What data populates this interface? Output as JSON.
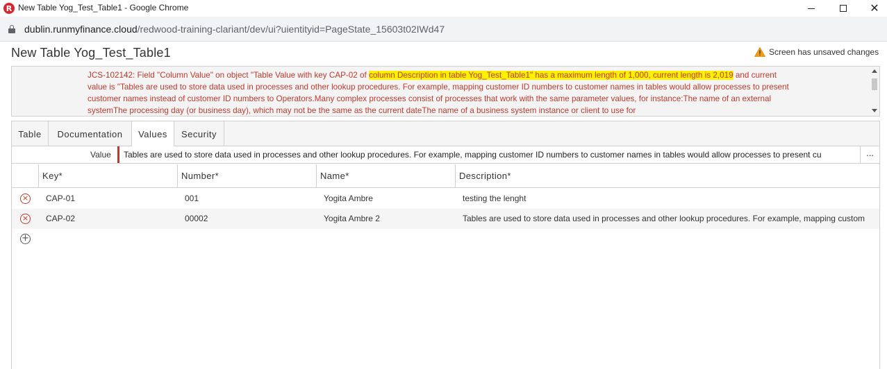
{
  "window": {
    "app_icon": "R",
    "title": "New Table Yog_Test_Table1 - Google Chrome",
    "close_glyph": "✕"
  },
  "addressbar": {
    "host": "dublin.runmyfinance.cloud",
    "path": "/redwood-training-clariant/dev/ui?uientityid=PageState_15603t02IWd47"
  },
  "page": {
    "title": "New Table Yog_Test_Table1",
    "unsaved_text": "Screen has unsaved changes"
  },
  "error": {
    "prefix": "JCS-102142: Field \"Column Value\" on object \"Table Value with key CAP-02 of ",
    "highlight": "column Description in table Yog_Test_Table1\" has a maximum length of 1,000, current length is 2,019",
    "suffix": " and current value is \"Tables are used to store data used in processes and other lookup procedures. For example, mapping customer ID numbers to customer names in tables would allow processes to present customer names instead of customer ID numbers to Operators.Many complex processes consist of processes that work with the same parameter values, for instance:The name of an external systemThe processing day (or business day), which may not be the same as the current dateThe name of a business system instance or client to use for"
  },
  "tabs": [
    {
      "label": "Table"
    },
    {
      "label": "Documentation"
    },
    {
      "label": "Values",
      "active": true
    },
    {
      "label": "Security"
    }
  ],
  "value_field": {
    "label": "Value",
    "value": "Tables are used to store data used in processes and other lookup procedures. For example, mapping customer ID numbers to customer names in tables would allow processes to present cu",
    "more": "..."
  },
  "grid": {
    "columns": [
      "Key*",
      "Number*",
      "Name*",
      "Description*"
    ],
    "rows": [
      {
        "key": "CAP-01",
        "number": "001",
        "name": "Yogita Ambre",
        "description": "testing the lenght"
      },
      {
        "key": "CAP-02",
        "number": "00002",
        "name": "Yogita Ambre 2",
        "description": "Tables are used to store data used in processes and other lookup procedures. For example, mapping custom"
      }
    ],
    "delete_glyph": "×",
    "add_glyph": "+"
  },
  "colors": {
    "error_red": "#c0392b",
    "highlight": "#fff200",
    "warning": "#f39c12"
  },
  "icons": {
    "app": "redwood-logo-icon",
    "lock": "lock-icon",
    "warning": "warning-icon",
    "delete": "delete-row-icon",
    "add": "add-row-icon"
  }
}
